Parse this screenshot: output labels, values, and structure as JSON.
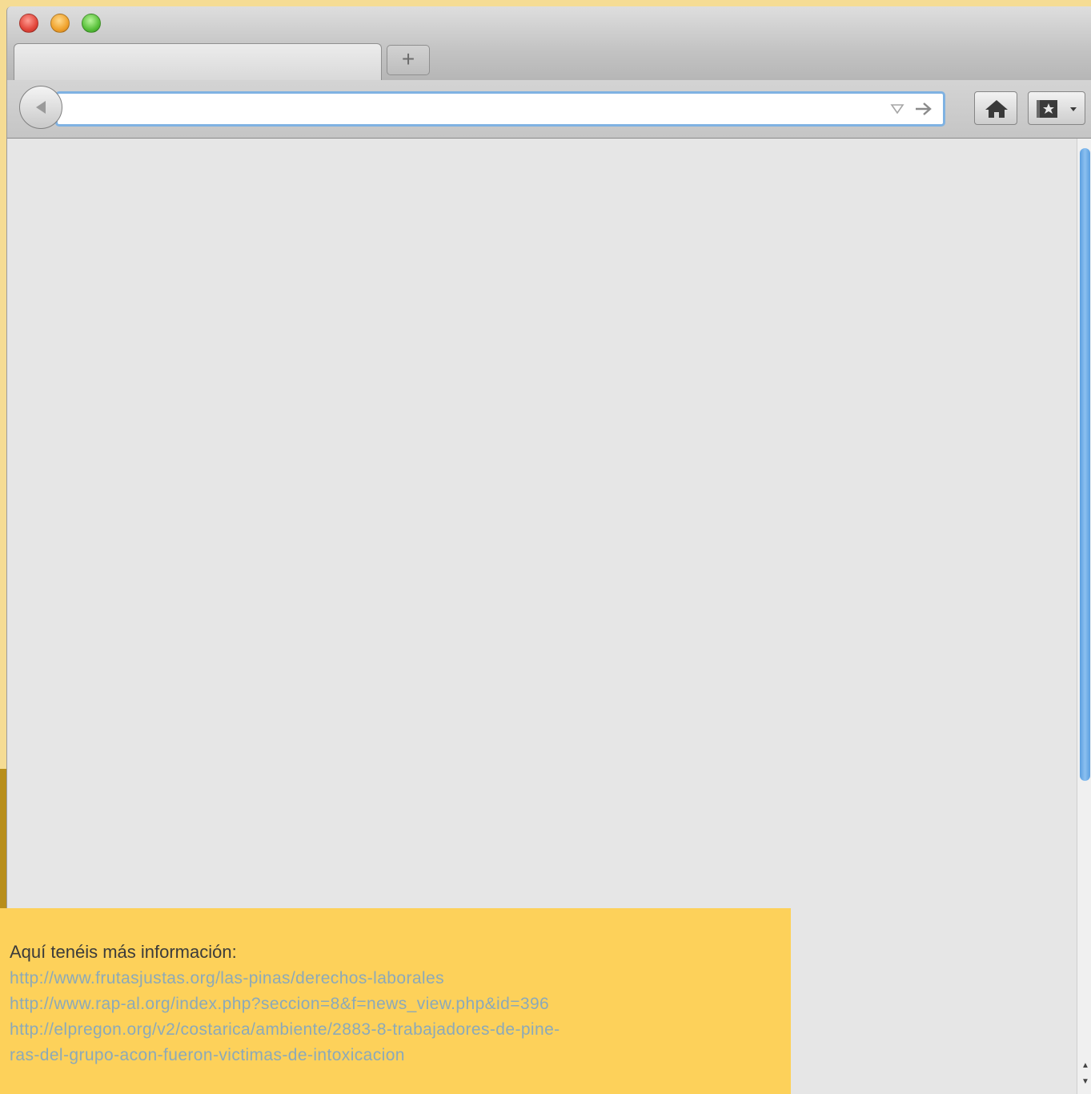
{
  "browser": {
    "tab": {
      "label": ""
    },
    "new_tab_label": "+",
    "url_bar": {
      "value": "",
      "placeholder": ""
    },
    "icons": [
      "close-icon",
      "minimize-icon",
      "zoom-icon",
      "back-arrow-icon",
      "dropdown-triangle-icon",
      "go-arrow-icon",
      "home-icon",
      "bookmarks-star-icon"
    ],
    "scrollbar": {
      "up_glyph": "▲",
      "down_glyph": "▼"
    }
  },
  "info": {
    "heading": "Aquí tenéis más información:",
    "links": [
      "http://www.frutasjustas.org/las-pinas/derechos-laborales",
      "http://www.rap-al.org/index.php?seccion=8&f=news_view.php&id=396",
      "http://elpregon.org/v2/costarica/ambiente/2883-8-trabajadores-de-pine-",
      "ras-del-grupo-acon-fueron-victimas-de-intoxicacion"
    ]
  },
  "colors": {
    "page_background": "#f5dc94",
    "info_box": "#fdd15a",
    "link_text": "#8ba9b9",
    "url_focus_ring": "#7fb2e2",
    "scroll_thumb": "#5b9fe0"
  }
}
